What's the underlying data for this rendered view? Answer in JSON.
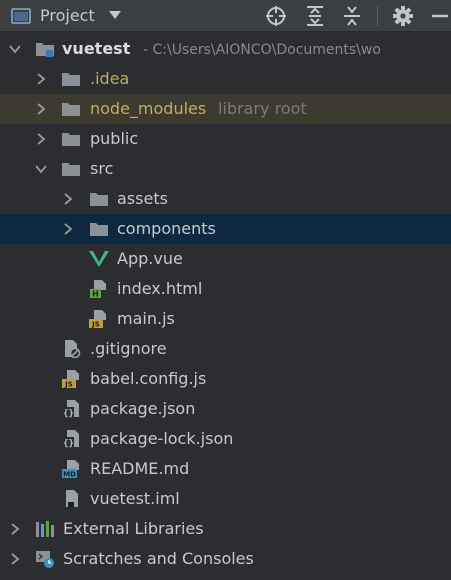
{
  "header": {
    "title": "Project",
    "icons": [
      "project-window-icon",
      "chevron-down-icon",
      "locate-icon",
      "expand-all-icon",
      "collapse-all-icon",
      "gear-icon",
      "hide-icon"
    ]
  },
  "tree": {
    "root": {
      "name": "vuetest",
      "path": "- C:\\Users\\AIONCO\\Documents\\wo"
    },
    "idea": ".idea",
    "node_modules": {
      "name": "node_modules",
      "extra": "library root"
    },
    "public": "public",
    "src": "src",
    "assets": "assets",
    "components": "components",
    "app_vue": "App.vue",
    "index_html": "index.html",
    "main_js": "main.js",
    "gitignore": ".gitignore",
    "babel_config": "babel.config.js",
    "package_json": "package.json",
    "package_lock": "package-lock.json",
    "readme": "README.md",
    "iml": "vuetest.iml",
    "external_libraries": "External Libraries",
    "scratches": "Scratches and Consoles"
  },
  "colors": {
    "background": "#2b2d30",
    "header": "#3c3f41",
    "selected_row": "#0e293f",
    "library_row": "#3d3a30",
    "excluded_text": "#bfb05a",
    "vue_green": "#41b883"
  }
}
